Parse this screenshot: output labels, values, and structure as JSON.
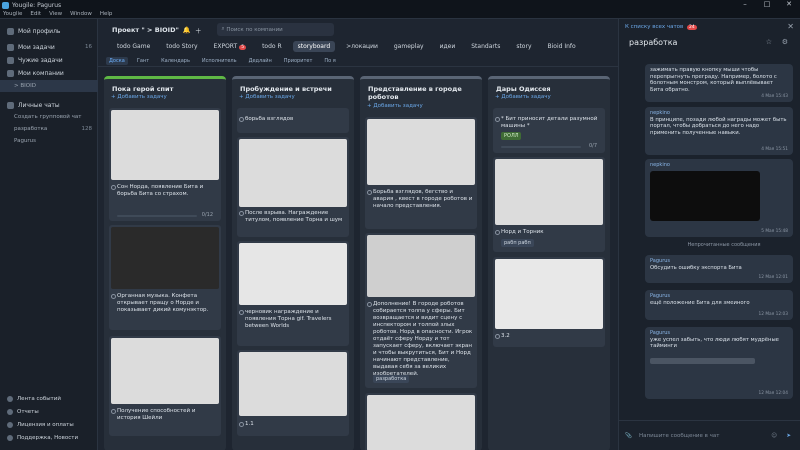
{
  "window": {
    "app": "Yougile: Pagurus",
    "menus": [
      "Youglie",
      "Edit",
      "View",
      "Window",
      "Help"
    ]
  },
  "sidebar": {
    "items": [
      {
        "label": "Мой профиль"
      },
      {
        "label": "Мои задачи",
        "count": "16"
      },
      {
        "label": "Чужие задачи"
      },
      {
        "label": "Мои компании"
      },
      {
        "label": "> BIOID"
      }
    ],
    "chats_header": "Личные чаты",
    "create_chat": "Создать групповой чат",
    "chats": [
      {
        "label": "разработка",
        "count": "128"
      },
      {
        "label": "Pagurus"
      }
    ],
    "bottom": [
      "Лента событий",
      "Отчеты",
      "Лицензия и оплаты",
      "Поддержка, Новости"
    ]
  },
  "topbar": {
    "project": "Проект \" > BIOID\"",
    "search_placeholder": "Поиск по компании"
  },
  "tabs": [
    {
      "label": "todo Game"
    },
    {
      "label": "todo Story"
    },
    {
      "label": "EXPORT",
      "badge": "5"
    },
    {
      "label": "todo R"
    },
    {
      "label": "storyboard",
      "active": true
    },
    {
      "label": ">локации"
    },
    {
      "label": "gameplay"
    },
    {
      "label": "идеи"
    },
    {
      "label": "Standarts"
    },
    {
      "label": "story"
    },
    {
      "label": "Bioid Info"
    }
  ],
  "views": [
    "Доска",
    "Гант",
    "Календарь",
    "Исполнитель",
    "Дедлайн",
    "Приоритет",
    "По я"
  ],
  "columns": [
    {
      "title": "Пока герой спит",
      "add": "+ Добавить задачу",
      "cards": [
        {
          "text": "Сон Норда, появление Бита и борьба Бита со страхом.",
          "progress": "0/12",
          "progress_value": 0.0
        },
        {
          "text": "Органная музыка. Конфета открывает пращу о Норде и показывает дикий комунэктор."
        },
        {
          "text": "Получение способностей и история Шейли"
        }
      ]
    },
    {
      "title": "Пробуждение и встречи",
      "add": "+ Добавить задачу",
      "cards": [
        {
          "text": "борьба взглядов"
        },
        {
          "text": "После взрыва. Награждение титулом, появление Торна и шум"
        },
        {
          "text": "черновик награждение и появления Торна gif. Travelers between Worlds"
        },
        {
          "text": "1.1"
        }
      ]
    },
    {
      "title": "Представление в городе роботов",
      "add": "+ Добавить задачу",
      "cards": [
        {
          "text": "Борьба взглядов, бегство и авария , квест в городе роботов и начало представления."
        },
        {
          "text": "Дополнение! В городе роботов собирается толпа у сферы. Бит возвращается и видит сцену с инспектором и толпой злых роботов. Норд в опасности. Игрок отдаёт сферу Норду и тот запускает сферу, включает экран и чтобы выкрутиться, Бит и Норд начинают представление, выдавая себя за великих изобретателей.",
          "tag": "разработка"
        }
      ]
    },
    {
      "title": "Дары Одиссея",
      "add": "+ Добавить задачу",
      "cards": [
        {
          "text": "* Бит приносит детали разумной машины *",
          "tag": "РОЛЛ",
          "progress": "0/7",
          "progress_value": 0.0
        },
        {
          "text": "Норд и Торник",
          "tag": "рабп рабп"
        },
        {
          "text": "3.2"
        }
      ]
    }
  ],
  "chat": {
    "back": "К списку всех чатов",
    "back_badge": "24",
    "title": "разработка",
    "messages": [
      {
        "author": "",
        "text": "зажимать правую кнопку мыши чтобы перепрыгнуть преграду. Например, болото с болотным монстром, который выплёвывает Бита обратно.",
        "time": "4 Мая 15:43"
      },
      {
        "author": "nepkino",
        "text": "В принципе, позади любой награды может быть портал, чтобы добраться до него надо применить полученные навыки.",
        "time": "4 Мая 15:51"
      },
      {
        "author": "nepkino",
        "text": "",
        "time": "5 Мая 15:48"
      },
      {
        "author": "Pagurus",
        "text": "Обсудить ошибку экспорта Бита",
        "time": "12 Мая 12:01"
      },
      {
        "author": "Pagurus",
        "text": "ещё положение Бита для змеиного",
        "time": "12 Мая 12:03"
      },
      {
        "author": "Pagurus",
        "text": "уже успел забыть, что люди любят мудрёные тайминги",
        "time": "12 Мая 12:04"
      }
    ],
    "unread_label": "Непрочитанные сообщения",
    "composer_placeholder": "Напишите сообщение в чат"
  },
  "colors": {
    "accent": "#6ba8e8",
    "green": "#5fb845",
    "badge": "#e04848"
  }
}
